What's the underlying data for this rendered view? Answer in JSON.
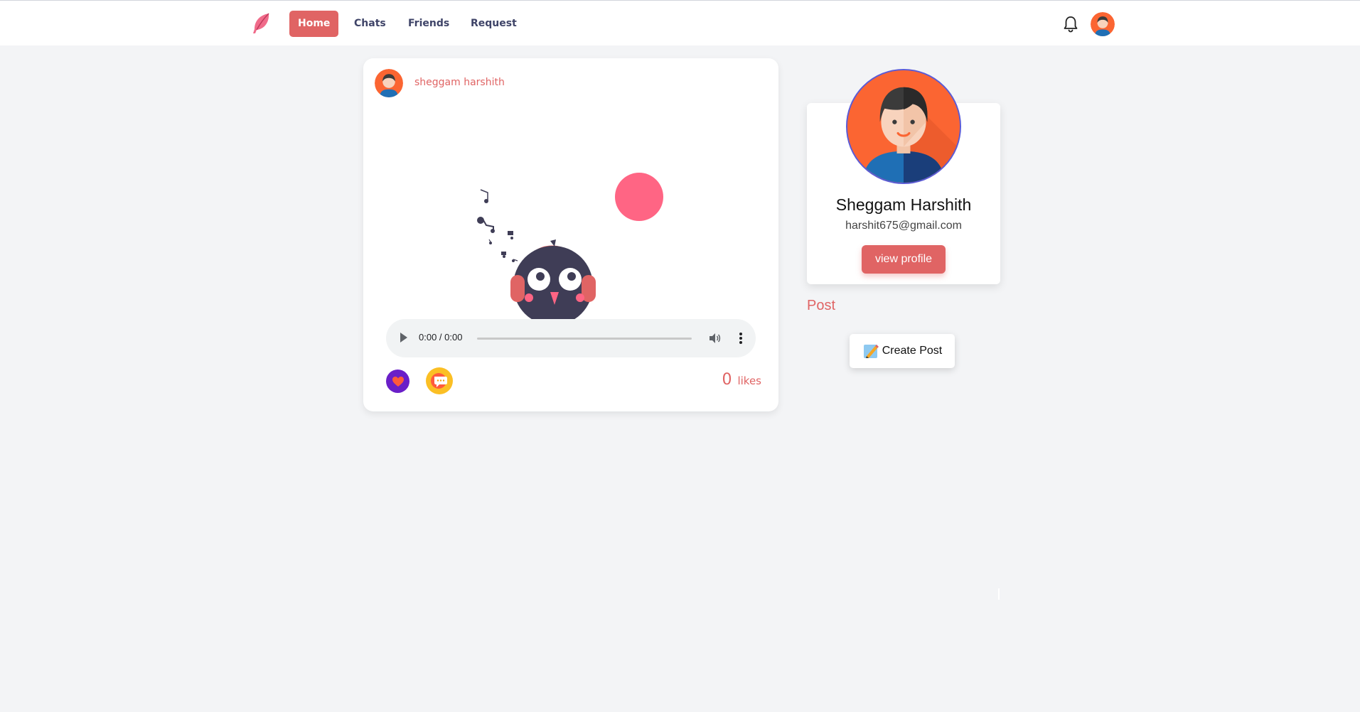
{
  "nav": {
    "items": [
      {
        "label": "Home",
        "active": true
      },
      {
        "label": "Chats",
        "active": false
      },
      {
        "label": "Friends",
        "active": false
      },
      {
        "label": "Request",
        "active": false
      }
    ],
    "icons": {
      "logo": "feather-logo",
      "notifications": "bell-icon",
      "avatar": "user-avatar"
    }
  },
  "post": {
    "author": "sheggam harshith",
    "audio": {
      "time": "0:00 / 0:00",
      "progress": 0
    },
    "likes_count": "0",
    "likes_label": "likes",
    "icons": {
      "like": "heart-icon",
      "comment": "comment-icon"
    }
  },
  "profile": {
    "name": "Sheggam Harshith",
    "email": "harshit675@gmail.com",
    "view_profile_label": "view profile"
  },
  "sidebar": {
    "post_heading": "Post",
    "create_post_label": "Create Post"
  },
  "colors": {
    "accent": "#e06464",
    "nav_text": "#3f4468",
    "background": "#f3f4f6",
    "like_button": "#6a1fc8",
    "comment_button": "#fbbf24"
  }
}
